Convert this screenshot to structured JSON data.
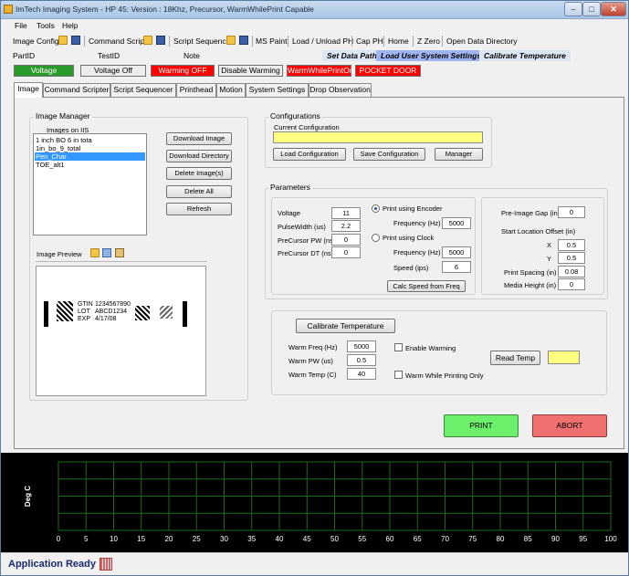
{
  "window": {
    "title": "ImTech Imaging System - HP 45: Version  : 18Khz, Precursor, WarmWhilePrint Capable",
    "controls": [
      "–",
      "□",
      "✕"
    ]
  },
  "menu": [
    "File",
    "Tools",
    "Help"
  ],
  "toolbar": {
    "image_config": "Image Config",
    "command_script": "Command Script",
    "script_sequence": "Script Sequence",
    "ms_paint": "MS Paint",
    "load_unload_ph": "Load / Unload PH",
    "cap_ph": "Cap PH",
    "home": "Home",
    "z_zero": "Z Zero",
    "open_data_directory": "Open Data Directory"
  },
  "toolbar2": {
    "part_id": "PartID",
    "test_id": "TestID",
    "note": "Note",
    "set_data_path": "Set Data Path",
    "load_user_system_settings": "Load User System Settings",
    "calibrate_temperature": "Calibrate Temperature"
  },
  "status_buttons": {
    "voltage": "Voltage",
    "voltage_off": "Voltage Off",
    "warming_off": "Warming OFF",
    "disable_warming": "Disable Warming",
    "warm_while_print_only": "WarmWhilePrintOnly",
    "pocket_door": "POCKET DOOR"
  },
  "tabs": [
    "Image",
    "Command Scripter",
    "Script Sequencer",
    "Printhead",
    "Motion",
    "System Settings",
    "Drop Observation"
  ],
  "image_manager": {
    "title": "Image Manager",
    "images_label": "Images on IIS",
    "images": [
      "1 inch BO 6 in tota",
      "1in_bo_9_total",
      "Pen_Char",
      "TOE_alt1"
    ],
    "selected_index": 2,
    "buttons": {
      "download_image": "Download Image",
      "download_directory": "Download Directory",
      "delete_images": "Delete Image(s)",
      "delete_all": "Delete All",
      "refresh": "Refresh"
    },
    "preview_label": "Image Preview",
    "preview": {
      "gtin_label": "GTIN",
      "gtin": "1234567890",
      "lot_label": "LOT",
      "lot": "ABCD1234",
      "exp_label": "EXP",
      "exp": "4/17/08"
    }
  },
  "configurations": {
    "title": "Configurations",
    "current_label": "Current Configuration",
    "current_value": "",
    "load": "Load Configuration",
    "save": "Save Configuration",
    "manager": "Manager"
  },
  "parameters": {
    "title": "Parameters",
    "voltage_label": "Voltage",
    "voltage": "11",
    "pulse_width_label": "PulseWidth (us)",
    "pulse_width": "2.2",
    "precursor_pw_label": "PreCursor PW (ns)",
    "precursor_pw": "0",
    "precursor_dt_label": "PreCursor DT (ns)",
    "precursor_dt": "0",
    "print_encoder": "Print using Encoder",
    "encoder_freq_label": "Frequency (Hz)",
    "encoder_freq": "5000",
    "print_clock": "Print using Clock",
    "clock_freq_label": "Frequency (Hz)",
    "clock_freq": "5000",
    "speed_label": "Speed (ips)",
    "speed": "6",
    "calc_speed": "Calc Speed from Freq",
    "pre_image_gap_label": "Pre-Image Gap (in)",
    "pre_image_gap": "0",
    "start_offset_label": "Start Location Offset (in)",
    "x_label": "X",
    "x": "0.5",
    "y_label": "Y",
    "y": "0.5",
    "print_spacing_label": "Print Spacing (in)",
    "print_spacing": "0.08",
    "media_height_label": "Media Height (in)",
    "media_height": "0"
  },
  "temperature": {
    "calibrate": "Calibrate Temperature",
    "warm_freq_label": "Warm Freq (Hz)",
    "warm_freq": "5000",
    "warm_pw_label": "Warm PW (us)",
    "warm_pw": "0.5",
    "warm_temp_label": "Warm Temp (C)",
    "warm_temp": "40",
    "enable_warming": "Enable Warming",
    "warm_while_printing_only": "Warm While Printing Only",
    "read_temp": "Read Temp",
    "temp_value": ""
  },
  "actions": {
    "print": "PRINT",
    "abort": "ABORT"
  },
  "chart_data": {
    "type": "line",
    "ylabel": "Deg C",
    "xlabel": "",
    "xlim": [
      0,
      100
    ],
    "x_ticks": [
      "0",
      "5",
      "10",
      "15",
      "20",
      "25",
      "30",
      "35",
      "40",
      "45",
      "50",
      "55",
      "60",
      "65",
      "70",
      "75",
      "80",
      "85",
      "90",
      "95",
      "100"
    ],
    "series": [],
    "grid": true
  },
  "status": {
    "text": "Application Ready"
  },
  "colors": {
    "voltage_green": "#2a9a2a",
    "warning_red": "#ff0000",
    "config_yellow": "#ffff80",
    "print_green": "#6cf06c",
    "abort_red": "#f07070",
    "chart_grid": "#1c6b1c"
  }
}
